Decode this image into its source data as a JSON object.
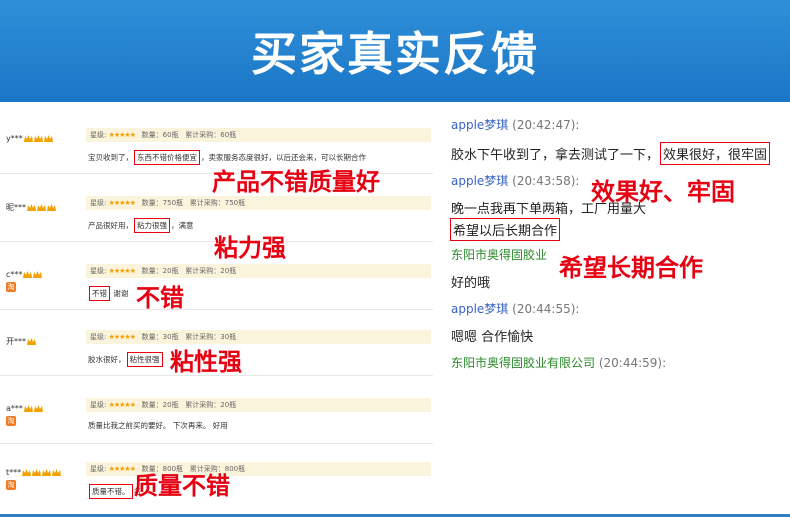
{
  "banner": {
    "title": "买家真实反馈"
  },
  "reviews": [
    {
      "user": "y***",
      "crowns": 3,
      "tao": false,
      "meta": {
        "rating_label": "星级:",
        "stars": "★★★★★",
        "qty": "数量：60瓶",
        "total": "累计采购：60瓶"
      },
      "text_before": "宝贝收到了，",
      "highlight": "东西不错价格便宜",
      "text_after": "，卖家服务态度很好，以后还会来，可以长期合作",
      "note": "产品不错质量好"
    },
    {
      "user": "昵***",
      "crowns": 3,
      "tao": false,
      "meta": {
        "rating_label": "星级:",
        "stars": "★★★★★",
        "qty": "数量：750瓶",
        "total": "累计采购：750瓶"
      },
      "text_before": "产品很好用，",
      "highlight": "粘力很强",
      "text_after": "，满意",
      "note": "粘力强"
    },
    {
      "user": "c***",
      "crowns": 2,
      "tao": true,
      "meta": {
        "rating_label": "星级:",
        "stars": "★★★★★",
        "qty": "数量：20瓶",
        "total": "累计采购：20瓶"
      },
      "text_before": "",
      "highlight": "不错",
      "text_after": " 谢谢",
      "note": "不错"
    },
    {
      "user": "开***",
      "crowns": 1,
      "tao": false,
      "meta": {
        "rating_label": "星级:",
        "stars": "★★★★★",
        "qty": "数量：30瓶",
        "total": "累计采购：30瓶"
      },
      "text_before": "胶水很好，",
      "highlight": "粘性很强",
      "text_after": "",
      "note": "粘性强"
    },
    {
      "user": "a***",
      "crowns": 2,
      "tao": true,
      "meta": {
        "rating_label": "星级:",
        "stars": "★★★★★",
        "qty": "数量：20瓶",
        "total": "累计采购：20瓶"
      },
      "text_before": "质量比我之前买的要好。 下次再来。 好用",
      "highlight": "",
      "text_after": "",
      "note": ""
    },
    {
      "user": "t***",
      "crowns": 4,
      "tao": true,
      "meta": {
        "rating_label": "星级:",
        "stars": "★★★★★",
        "qty": "数量：800瓶",
        "total": "累计采购：800瓶"
      },
      "text_before": "",
      "highlight": "质量不错。",
      "text_after": "名",
      "note": "质量不错"
    }
  ],
  "chat": {
    "lines": [
      {
        "kind": "header",
        "sender": "apple梦琪",
        "time": "(20:42:47):",
        "company": false
      },
      {
        "kind": "msg",
        "before": "胶水下午收到了，拿去测试了一下，",
        "highlight": "效果很好，很牢固"
      },
      {
        "kind": "header",
        "sender": "apple梦琪",
        "time": "(20:43:58):",
        "company": false
      },
      {
        "kind": "msg",
        "before": "晚一点我再下单两箱，工厂用量大",
        "highlight": ""
      },
      {
        "kind": "msg",
        "before": "",
        "highlight": "希望以后长期合作"
      },
      {
        "kind": "header",
        "sender": "东阳市奥得固胶业",
        "time": "",
        "company": true
      },
      {
        "kind": "msg",
        "before": "好的哦",
        "highlight": ""
      },
      {
        "kind": "header",
        "sender": "apple梦琪",
        "time": "(20:44:55):",
        "company": false
      },
      {
        "kind": "msg",
        "before": "嗯嗯  合作愉快",
        "highlight": ""
      },
      {
        "kind": "header",
        "sender": "东阳市奥得固胶业有限公司",
        "time": "(20:44:59):",
        "company": true
      }
    ],
    "notes": [
      "效果好、牢固",
      "希望长期合作"
    ]
  },
  "colors": {
    "banner": "#1a76c6",
    "accent_red": "#e60012",
    "sender_blue": "#3a63c4",
    "company_green": "#2a8a2a"
  }
}
